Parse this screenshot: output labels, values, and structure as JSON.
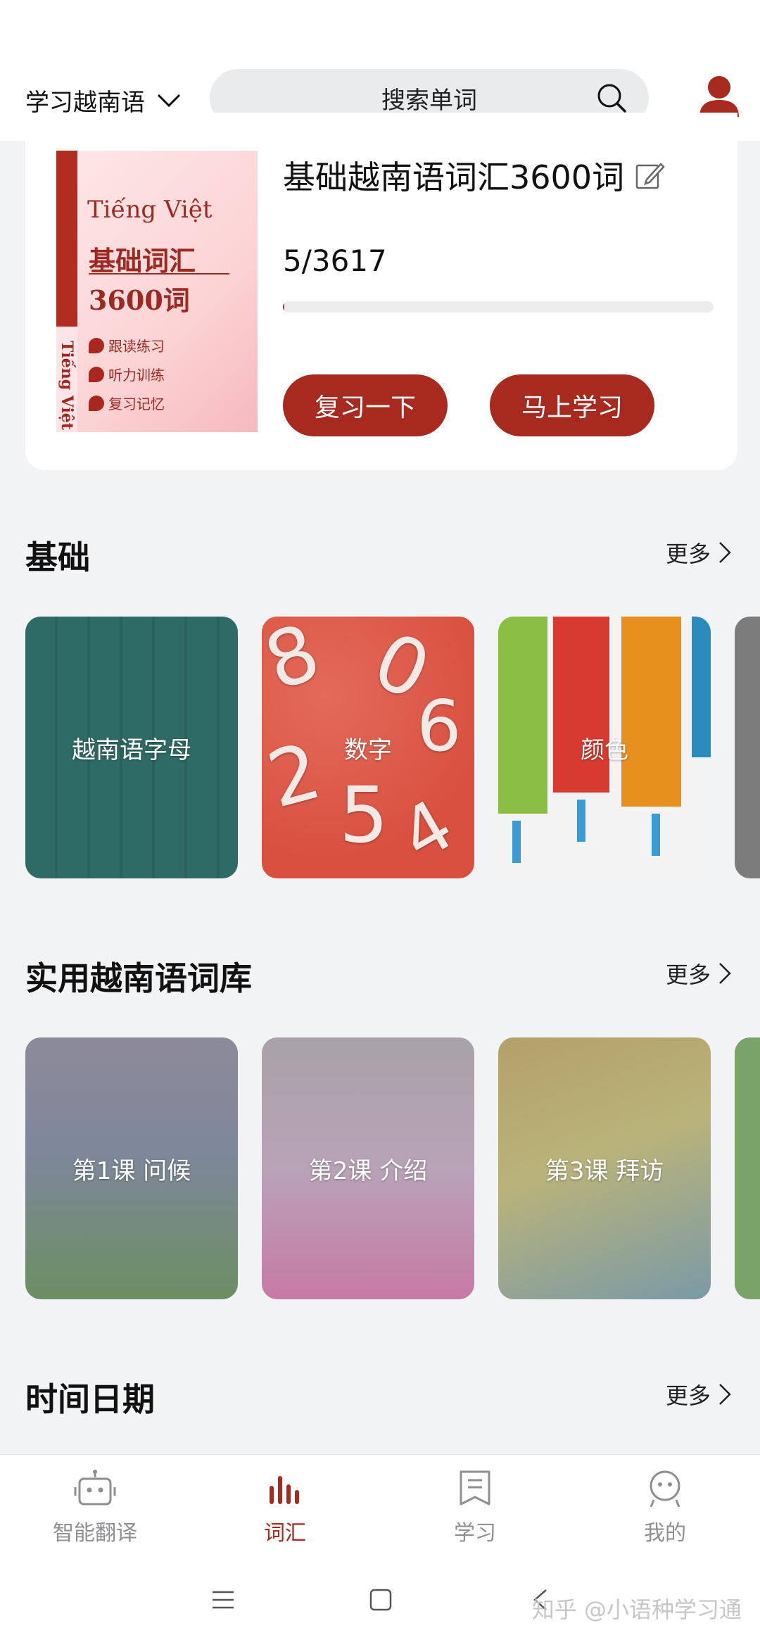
{
  "header": {
    "language_select": "学习越南语",
    "search_placeholder": "搜索单词"
  },
  "book": {
    "cover": {
      "title": "Tiếng Việt",
      "subtitle_line1": "基础词汇",
      "subtitle_line2": "3600词",
      "bullets": [
        "跟读练习",
        "听力训练",
        "复习记忆"
      ],
      "spine_text": "Tiếng Việt"
    },
    "title": "基础越南语词汇3600词",
    "progress_text": "5/3617",
    "progress_fraction": 0.0014,
    "review_button": "复习一下",
    "learn_button": "马上学习"
  },
  "sections": [
    {
      "title": "基础",
      "more": "更多",
      "tiles": [
        "越南语字母",
        "数字",
        "颜色"
      ]
    },
    {
      "title": "实用越南语词库",
      "more": "更多",
      "tiles": [
        "第1课 问候",
        "第2课 介绍",
        "第3课 拜访"
      ]
    },
    {
      "title": "时间日期",
      "more": "更多"
    }
  ],
  "bottom_nav": [
    {
      "label": "智能翻译",
      "icon": "robot-icon"
    },
    {
      "label": "词汇",
      "icon": "bar-chart-icon",
      "active": true
    },
    {
      "label": "学习",
      "icon": "bookmark-icon"
    },
    {
      "label": "我的",
      "icon": "face-icon"
    }
  ],
  "watermark": "知乎 @小语种学习通",
  "colors": {
    "accent": "#a82a1e",
    "background": "#f2f3f5",
    "nav_inactive": "#8e8e93"
  }
}
